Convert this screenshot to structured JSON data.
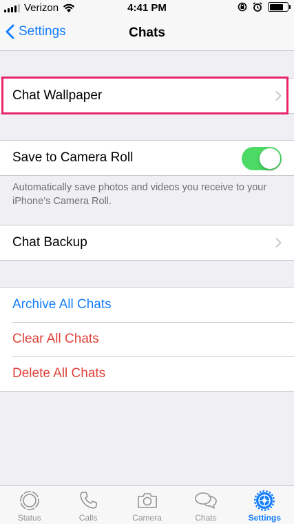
{
  "status_bar": {
    "carrier": "Verizon",
    "time": "4:41 PM",
    "battery_level": 0.8
  },
  "nav": {
    "back_label": "Settings",
    "title": "Chats"
  },
  "wallpaper_row": {
    "label": "Chat Wallpaper"
  },
  "camera_roll": {
    "label": "Save to Camera Roll",
    "enabled": true,
    "footer": "Automatically save photos and videos you receive to your iPhone’s Camera Roll."
  },
  "backup_row": {
    "label": "Chat Backup"
  },
  "actions": {
    "archive": "Archive All Chats",
    "clear": "Clear All Chats",
    "delete": "Delete All Chats"
  },
  "tabs": [
    {
      "label": "Status",
      "icon": "status-icon"
    },
    {
      "label": "Calls",
      "icon": "phone-icon"
    },
    {
      "label": "Camera",
      "icon": "camera-icon"
    },
    {
      "label": "Chats",
      "icon": "chat-bubbles-icon"
    },
    {
      "label": "Settings",
      "icon": "gear-icon",
      "active": true
    }
  ],
  "colors": {
    "accent": "#147efb",
    "destructive": "#e0433b",
    "toggle_on": "#4cd964",
    "highlight": "#e8246b"
  }
}
